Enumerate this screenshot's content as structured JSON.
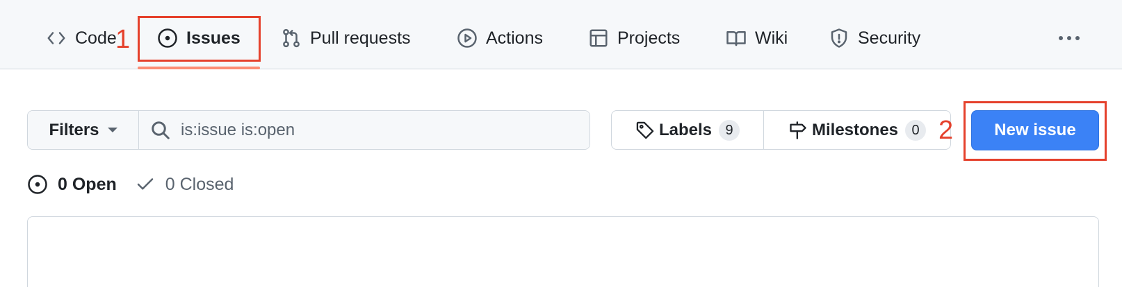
{
  "nav": {
    "items": [
      {
        "label": "Code",
        "icon": "code-icon"
      },
      {
        "label": "Issues",
        "icon": "issue-opened-icon",
        "active": true
      },
      {
        "label": "Pull requests",
        "icon": "git-pull-request-icon"
      },
      {
        "label": "Actions",
        "icon": "play-icon"
      },
      {
        "label": "Projects",
        "icon": "table-icon"
      },
      {
        "label": "Wiki",
        "icon": "book-icon"
      },
      {
        "label": "Security",
        "icon": "shield-icon"
      }
    ],
    "more_icon": "kebab-horizontal-icon"
  },
  "annotations": {
    "one": "1",
    "two": "2",
    "color": "#e5412c"
  },
  "toolbar": {
    "filters_label": "Filters",
    "search_value": "is:issue is:open",
    "labels_label": "Labels",
    "labels_count": "9",
    "milestones_label": "Milestones",
    "milestones_count": "0",
    "new_issue_label": "New issue"
  },
  "states": {
    "open_label": "0 Open",
    "closed_label": "0 Closed"
  },
  "colors": {
    "primary_button": "#3b82f6",
    "active_underline": "#fd8c73"
  }
}
